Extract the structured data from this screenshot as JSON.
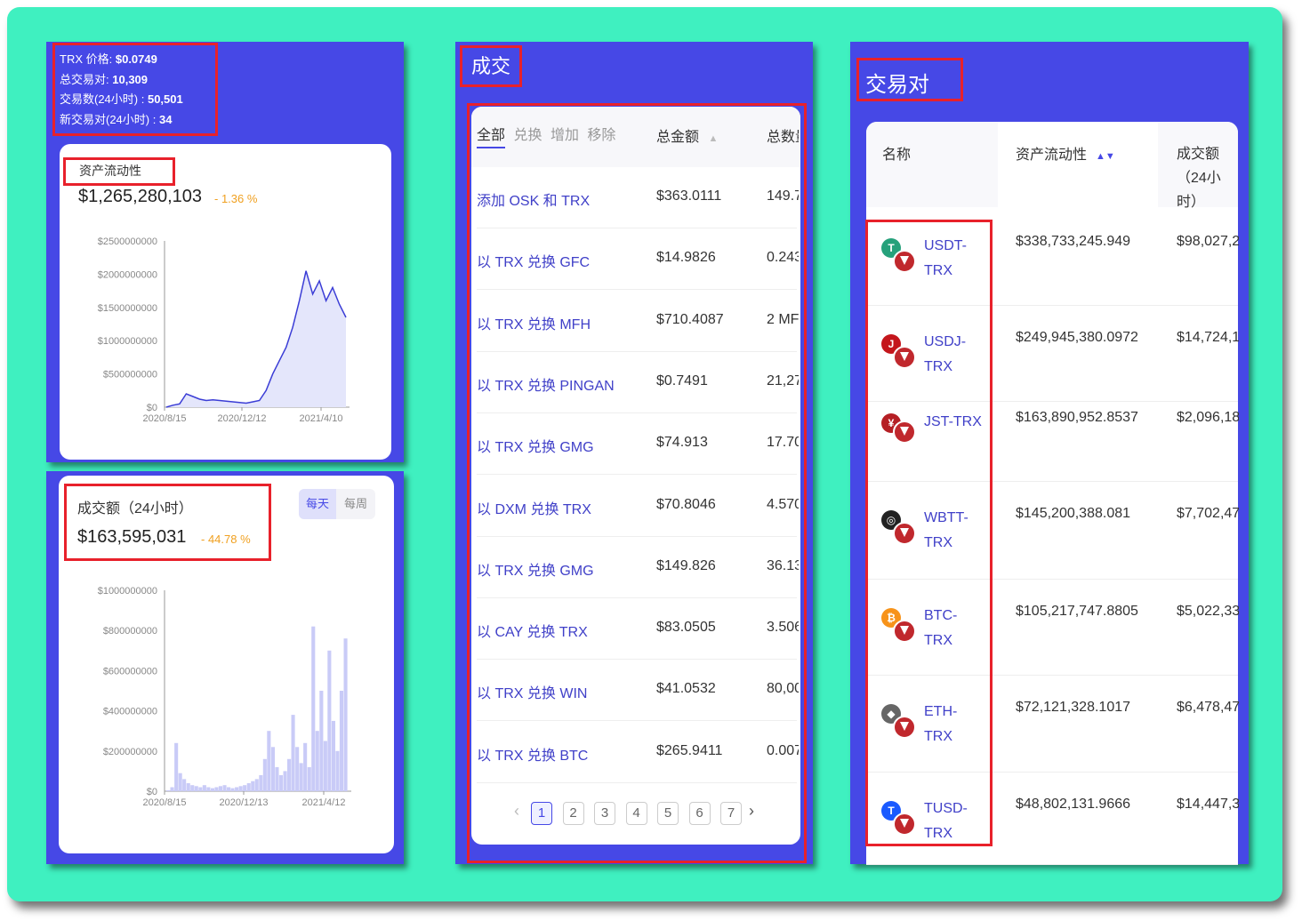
{
  "stats": {
    "price_label": "TRX 价格:",
    "price": "$0.0749",
    "pairs_label": "总交易对:",
    "pairs": "10,309",
    "tx_label": "交易数(24小时) :",
    "tx": "50,501",
    "new_label": "新交易对(24小时) :",
    "new_pairs": "34"
  },
  "liquidity": {
    "label": "资产流动性",
    "value": "$1,265,280,103",
    "change": "- 1.36 %"
  },
  "volume": {
    "label": "成交额（24小时）",
    "value": "$163,595,031",
    "change": "- 44.78 %",
    "toggle": [
      "每天",
      "每周"
    ]
  },
  "trades": {
    "title": "成交",
    "tabs": [
      "全部",
      "兑换",
      "增加",
      "移除"
    ],
    "col_amount": "总金额",
    "col_qty": "总数量",
    "rows": [
      {
        "name": "添加 OSK 和 TRX",
        "amount": "$363.0111",
        "qty": "149.7"
      },
      {
        "name": "以 TRX 兑换 GFC",
        "amount": "$14.9826",
        "qty": "0.243"
      },
      {
        "name": "以 TRX 兑换 MFH",
        "amount": "$710.4087",
        "qty": "2 MFH"
      },
      {
        "name": "以 TRX 兑换 PINGAN",
        "amount": "$0.7491",
        "qty": "21,27"
      },
      {
        "name": "以 TRX 兑换 GMG",
        "amount": "$74.913",
        "qty": "17.70"
      },
      {
        "name": "以 DXM 兑换 TRX",
        "amount": "$70.8046",
        "qty": "4.570"
      },
      {
        "name": "以 TRX 兑换 GMG",
        "amount": "$149.826",
        "qty": "36.13"
      },
      {
        "name": "以 CAY 兑换 TRX",
        "amount": "$83.0505",
        "qty": "3.506"
      },
      {
        "name": "以 TRX 兑换 WIN",
        "amount": "$41.0532",
        "qty": "80,00"
      },
      {
        "name": "以 TRX 兑换 BTC",
        "amount": "$265.9411",
        "qty": "0.007"
      }
    ],
    "pages": [
      "1",
      "2",
      "3",
      "4",
      "5",
      "6",
      "7"
    ]
  },
  "pairs_panel": {
    "title": "交易对",
    "col_name": "名称",
    "col_liq": "资产流动性",
    "col_vol": "成交额（24小时）",
    "rows": [
      {
        "l1": "USDT-",
        "l2": "TRX",
        "liq": "$338,733,245.949",
        "vol": "$98,027,2",
        "color": "#26a17b",
        "glyph": "T"
      },
      {
        "l1": "USDJ-",
        "l2": "TRX",
        "liq": "$249,945,380.0972",
        "vol": "$14,724,1",
        "color": "#c4161c",
        "glyph": "J"
      },
      {
        "l1": "JST-TRX",
        "l2": "",
        "liq": "$163,890,952.8537",
        "vol": "$2,096,18",
        "color": "#b51f24",
        "glyph": "¥"
      },
      {
        "l1": "WBTT-",
        "l2": "TRX",
        "liq": "$145,200,388.081",
        "vol": "$7,702,47",
        "color": "#222222",
        "glyph": "◎"
      },
      {
        "l1": "BTC-",
        "l2": "TRX",
        "liq": "$105,217,747.8805",
        "vol": "$5,022,33",
        "color": "#f7931a",
        "glyph": "₿"
      },
      {
        "l1": "ETH-",
        "l2": "TRX",
        "liq": "$72,121,328.1017",
        "vol": "$6,478,47",
        "color": "#666666",
        "glyph": "◆"
      },
      {
        "l1": "TUSD-",
        "l2": "TRX",
        "liq": "$48,802,131.9666",
        "vol": "$14,447,3",
        "color": "#1a5aff",
        "glyph": "T"
      }
    ]
  },
  "chart_data": [
    {
      "type": "area",
      "title": "资产流动性",
      "x_ticks": [
        "2020/8/15",
        "2020/12/12",
        "2021/4/10"
      ],
      "y_ticks": [
        "$0",
        "$500000000",
        "$1000000000",
        "$1500000000",
        "$2000000000",
        "$2500000000"
      ],
      "ylim": [
        0,
        2500000000
      ],
      "values": [
        0,
        30000000,
        50000000,
        200000000,
        160000000,
        120000000,
        100000000,
        110000000,
        100000000,
        90000000,
        80000000,
        70000000,
        60000000,
        80000000,
        100000000,
        250000000,
        500000000,
        700000000,
        900000000,
        1200000000,
        1600000000,
        2050000000,
        1700000000,
        1900000000,
        1600000000,
        1800000000,
        1550000000,
        1350000000
      ]
    },
    {
      "type": "bar",
      "title": "成交额（24小时）",
      "x_ticks": [
        "2020/8/15",
        "2020/12/13",
        "2021/4/12"
      ],
      "y_ticks": [
        "$0",
        "$200000000",
        "$400000000",
        "$600000000",
        "$800000000",
        "$1000000000"
      ],
      "ylim": [
        0,
        1000000000
      ],
      "values": [
        5000000,
        20000000,
        240000000,
        90000000,
        60000000,
        40000000,
        30000000,
        25000000,
        20000000,
        30000000,
        20000000,
        15000000,
        20000000,
        25000000,
        30000000,
        20000000,
        15000000,
        20000000,
        25000000,
        30000000,
        40000000,
        50000000,
        60000000,
        80000000,
        160000000,
        300000000,
        220000000,
        120000000,
        80000000,
        100000000,
        160000000,
        380000000,
        220000000,
        140000000,
        240000000,
        120000000,
        820000000,
        300000000,
        500000000,
        250000000,
        700000000,
        350000000,
        200000000,
        500000000,
        760000000
      ]
    }
  ]
}
